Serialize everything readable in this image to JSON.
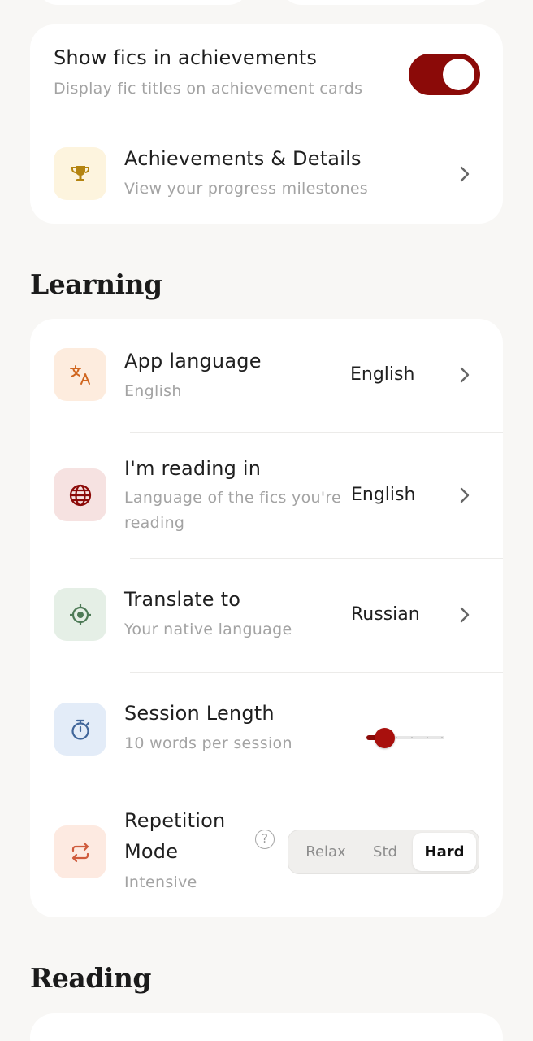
{
  "achievements_card": {
    "show_fics": {
      "title": "Show fics in achievements",
      "subtitle": "Display fic titles on achievement cards",
      "enabled": true
    },
    "achievements": {
      "title": "Achievements & Details",
      "subtitle": "View your progress milestones",
      "icon": "trophy-icon"
    }
  },
  "learning": {
    "heading": "Learning",
    "app_language": {
      "title": "App language",
      "subtitle": "English",
      "value": "English",
      "icon": "translate-icon"
    },
    "reading_in": {
      "title": "I'm reading in",
      "subtitle_line1": "Language of the fics you're",
      "subtitle_line2": "reading",
      "value": "English",
      "icon": "globe-icon"
    },
    "translate_to": {
      "title": "Translate to",
      "subtitle": "Your native language",
      "value": "Russian",
      "icon": "target-icon"
    },
    "session_length": {
      "title": "Session Length",
      "subtitle": "10 words per session",
      "icon": "stopwatch-icon",
      "slider_level": 0
    },
    "repetition_mode": {
      "title_line1": "Repetition",
      "title_line2": "Mode",
      "subtitle": "Intensive",
      "help": "?",
      "icon": "repeat-icon",
      "options": [
        "Relax",
        "Std",
        "Hard"
      ],
      "selected": "Hard"
    }
  },
  "reading": {
    "heading": "Reading"
  },
  "colors": {
    "accent": "#8b0a08",
    "background": "#f8f7f5",
    "card": "#ffffff"
  }
}
